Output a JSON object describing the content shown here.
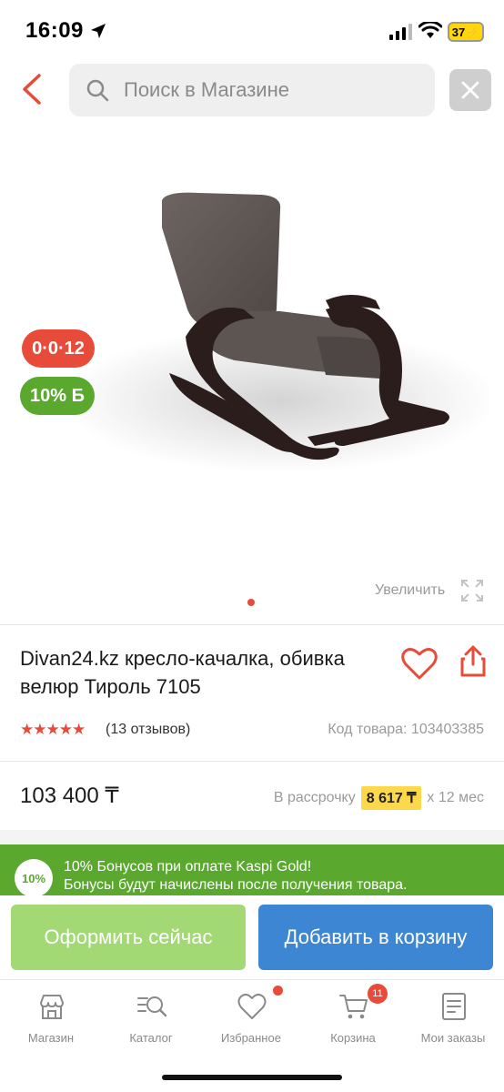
{
  "status_bar": {
    "time": "16:09",
    "battery": "37"
  },
  "header": {
    "search_placeholder": "Поиск в Магазине"
  },
  "product_image": {
    "badge_installment": "0·0·12",
    "badge_bonus": "10% Б",
    "zoom_label": "Увеличить"
  },
  "product": {
    "title": "Divan24.kz кресло-качалка, обивка велюр Тироль 7105",
    "rating_stars": "★★★★★",
    "reviews": "(13 отзывов)",
    "sku": "Код товара: 103403385",
    "price": "103 400 ₸",
    "installment_prefix": "В рассрочку",
    "installment_amount": "8 617 ₸",
    "installment_suffix": "x 12 мес"
  },
  "bonus_banner": {
    "badge": "10%",
    "line1": "10% Бонусов при оплате Kaspi Gold!",
    "line2": "Бонусы будут начислены после получения товара."
  },
  "actions": {
    "buy_now": "Оформить сейчас",
    "add_to_cart": "Добавить в корзину"
  },
  "bottom_nav": {
    "items": [
      {
        "label": "Магазин",
        "icon": "store-icon"
      },
      {
        "label": "Каталог",
        "icon": "catalog-icon"
      },
      {
        "label": "Избранное",
        "icon": "heart-icon"
      },
      {
        "label": "Корзина",
        "icon": "cart-icon"
      },
      {
        "label": "Мои заказы",
        "icon": "orders-icon"
      }
    ],
    "cart_count": "11"
  },
  "colors": {
    "accent_red": "#e84b3a",
    "bonus_green": "#5aa82e",
    "buy_now_green": "#a3d975",
    "cart_blue": "#3d86d4",
    "installment_yellow": "#fdd84b"
  }
}
